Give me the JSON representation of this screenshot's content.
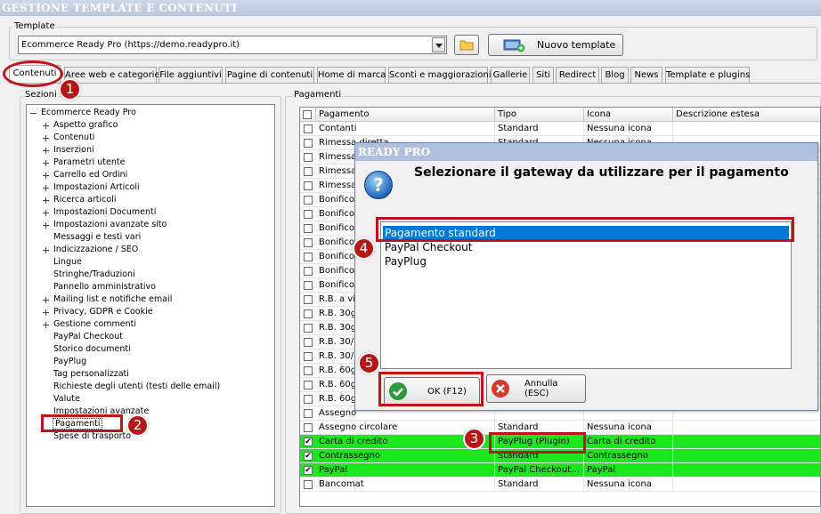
{
  "window": {
    "title": "GESTIONE TEMPLATE E CONTENUTI"
  },
  "template_group": {
    "label": "Template",
    "combo_value": "Ecommerce Ready Pro (https://demo.readypro.it)",
    "new_template_label": "Nuovo template"
  },
  "tabs": [
    {
      "label": "Contenuti",
      "active": true
    },
    {
      "label": "Aree web e categorie"
    },
    {
      "label": "File aggiuntivi"
    },
    {
      "label": "Pagine di contenuti"
    },
    {
      "label": "Home di marca"
    },
    {
      "label": "Sconti e maggiorazioni"
    },
    {
      "label": "Gallerie"
    },
    {
      "label": "Siti"
    },
    {
      "label": "Redirect"
    },
    {
      "label": "Blog"
    },
    {
      "label": "News"
    },
    {
      "label": "Template e plugins"
    }
  ],
  "sections": {
    "label": "Sezioni",
    "root": "Ecommerce Ready Pro",
    "items": [
      {
        "label": "Aspetto grafico",
        "expander": true
      },
      {
        "label": "Contenuti",
        "expander": true
      },
      {
        "label": "Inserzioni",
        "expander": true
      },
      {
        "label": "Parametri utente",
        "expander": true
      },
      {
        "label": "Carrello ed Ordini",
        "expander": true
      },
      {
        "label": "Impostazioni Articoli",
        "expander": true
      },
      {
        "label": "Ricerca articoli",
        "expander": true
      },
      {
        "label": "Impostazioni Documenti",
        "expander": true
      },
      {
        "label": "Impostazioni avanzate sito",
        "expander": true
      },
      {
        "label": "Messaggi e testi vari",
        "expander": false
      },
      {
        "label": "Indicizzazione / SEO",
        "expander": true
      },
      {
        "label": "Lingue",
        "expander": false
      },
      {
        "label": "Stringhe/Traduzioni",
        "expander": false
      },
      {
        "label": "Pannello amministrativo",
        "expander": false
      },
      {
        "label": "Mailing list e notifiche email",
        "expander": true
      },
      {
        "label": "Privacy, GDPR e Cookie",
        "expander": true
      },
      {
        "label": "Gestione commenti",
        "expander": true
      },
      {
        "label": "PayPal Checkout",
        "expander": false
      },
      {
        "label": "Storico documenti",
        "expander": false
      },
      {
        "label": "PayPlug",
        "expander": false
      },
      {
        "label": "Tag personalizzati",
        "expander": false
      },
      {
        "label": "Richieste degli utenti (testi delle email)",
        "expander": false
      },
      {
        "label": "Valute",
        "expander": false
      },
      {
        "label": "Impostazioni avanzate",
        "expander": false
      },
      {
        "label": "Pagamenti",
        "expander": false,
        "selected": true
      },
      {
        "label": "Spese di trasporto",
        "expander": false
      }
    ]
  },
  "payments": {
    "label": "Pagamenti",
    "headers": [
      "Pagamento",
      "Tipo",
      "Icona",
      "Descrizione estesa"
    ],
    "rows": [
      {
        "name": "Contanti",
        "type": "Standard",
        "icon": "Nessuna icona",
        "checked": false,
        "green": false
      },
      {
        "name": "Rimessa diretta",
        "type": "Standard",
        "icon": "Nessuna icona",
        "checked": false,
        "green": false
      },
      {
        "name": "Rimessa",
        "type": "",
        "icon": "",
        "checked": false,
        "green": false
      },
      {
        "name": "Rimessa",
        "type": "",
        "icon": "",
        "checked": false,
        "green": false
      },
      {
        "name": "Rimessa",
        "type": "",
        "icon": "",
        "checked": false,
        "green": false
      },
      {
        "name": "Bonifico",
        "type": "",
        "icon": "",
        "checked": false,
        "green": false
      },
      {
        "name": "Bonifico",
        "type": "",
        "icon": "",
        "checked": false,
        "green": false
      },
      {
        "name": "Bonifico",
        "type": "",
        "icon": "",
        "checked": false,
        "green": false
      },
      {
        "name": "Bonifico",
        "type": "",
        "icon": "",
        "checked": false,
        "green": false
      },
      {
        "name": "Bonifico",
        "type": "",
        "icon": "",
        "checked": false,
        "green": false
      },
      {
        "name": "Bonifico",
        "type": "",
        "icon": "",
        "checked": false,
        "green": false
      },
      {
        "name": "Bonifico",
        "type": "",
        "icon": "",
        "checked": false,
        "green": false
      },
      {
        "name": "R.B. a vi",
        "type": "",
        "icon": "",
        "checked": false,
        "green": false
      },
      {
        "name": "R.B. 30g",
        "type": "",
        "icon": "",
        "checked": false,
        "green": false
      },
      {
        "name": "R.B. 30g",
        "type": "",
        "icon": "",
        "checked": false,
        "green": false
      },
      {
        "name": "R.B. 30/",
        "type": "",
        "icon": "",
        "checked": false,
        "green": false
      },
      {
        "name": "R.B. 30/",
        "type": "",
        "icon": "",
        "checked": false,
        "green": false
      },
      {
        "name": "R.B. 60g",
        "type": "",
        "icon": "",
        "checked": false,
        "green": false
      },
      {
        "name": "R.B. 60g",
        "type": "",
        "icon": "",
        "checked": false,
        "green": false
      },
      {
        "name": "R.B. 60g",
        "type": "",
        "icon": "",
        "checked": false,
        "green": false
      },
      {
        "name": "Assegno",
        "type": "",
        "icon": "",
        "checked": false,
        "green": false
      },
      {
        "name": "Assegno circolare",
        "type": "Standard",
        "icon": "Nessuna icona",
        "checked": false,
        "green": false
      },
      {
        "name": "Carta di credito",
        "type": "PayPlug (Plugin)",
        "icon": "Carta di credito",
        "checked": true,
        "green": true
      },
      {
        "name": "Contrassegno",
        "type": "Standard",
        "icon": "Contrassegno",
        "checked": true,
        "green": true
      },
      {
        "name": "PayPal",
        "type": "PayPal Checkout…",
        "icon": "PayPal",
        "checked": true,
        "green": true
      },
      {
        "name": "Bancomat",
        "type": "Standard",
        "icon": "Nessuna icona",
        "checked": false,
        "green": false
      }
    ]
  },
  "dialog": {
    "title": "READY PRO",
    "message": "Selezionare il gateway da utilizzare per il pagamento",
    "options": [
      "Pagamento standard",
      "PayPal Checkout",
      "PayPlug"
    ],
    "selected_index": 0,
    "ok_label": "OK (F12)",
    "cancel_label": "Annulla (ESC)"
  },
  "badges": [
    "1",
    "2",
    "3",
    "4",
    "5"
  ],
  "colors": {
    "highlight": "#c0141b",
    "selection": "#0078d7",
    "row_green": "#1ee61e",
    "badge": "#b51717"
  }
}
